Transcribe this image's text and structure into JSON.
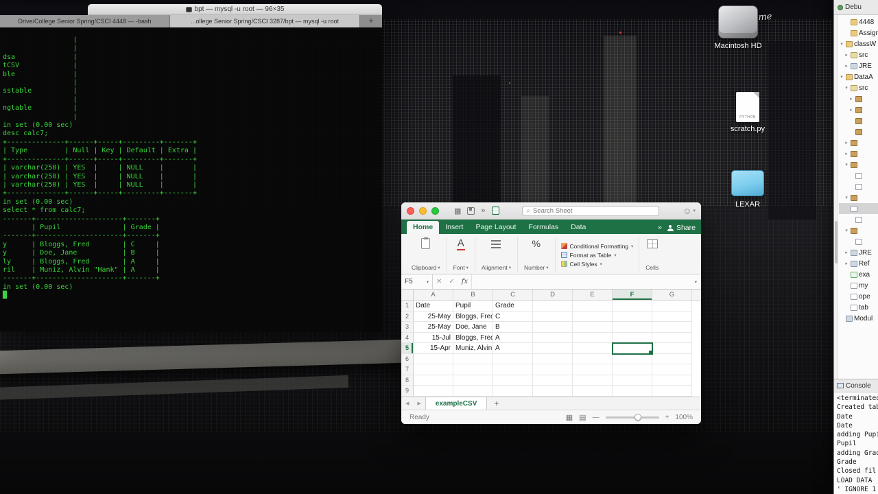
{
  "colors": {
    "excel_green": "#1e7145",
    "terminal_green": "#3cd43c"
  },
  "icons": {
    "search": "⌕",
    "smiley": "☺",
    "chevron_down": "▾",
    "overflow": "»",
    "cancel": "✕",
    "enter": "✓",
    "fx": "fx",
    "prev": "◀",
    "next": "▶",
    "plus": "+",
    "minus": "—",
    "grid_view": "▦",
    "page_view": "▤",
    "font": "A",
    "percent": "%"
  },
  "wallpaper": {
    "watermark": "b.me"
  },
  "terminal": {
    "title": "bpt — mysql -u root — 96×35",
    "new_tab_label": "+",
    "tabs": [
      {
        "label": "Drive/College Senior Spring/CSCI 4448 — -bash",
        "active": false
      },
      {
        "label": "...ollege Senior Spring/CSCI 3287/bpt — mysql -u root",
        "active": true
      }
    ],
    "lines": [
      "                 |",
      "                 |",
      "dsa              |",
      "tCSV             |",
      "ble              |",
      "                 |",
      "sstable          |",
      "                 |",
      "ngtable          |",
      "                 |",
      "in set (0.00 sec)",
      "",
      "desc calc7;",
      "+--------------+------+-----+---------+-------+",
      "| Type         | Null | Key | Default | Extra |",
      "+--------------+------+-----+---------+-------+",
      "| varchar(250) | YES  |     | NULL    |       |",
      "| varchar(250) | YES  |     | NULL    |       |",
      "| varchar(250) | YES  |     | NULL    |       |",
      "+--------------+------+-----+---------+-------+",
      "in set (0.00 sec)",
      "",
      "select * from calc7;",
      "-------+---------------------+-------+",
      "       | Pupil               | Grade |",
      "-------+---------------------+-------+",
      "y      | Bloggs, Fred        | C     |",
      "y      | Doe, Jane           | B     |",
      "ly     | Bloggs, Fred        | A     |",
      "ril    | Muniz, Alvin \"Hank\" | A     |",
      "-------+---------------------+-------+",
      "in set (0.00 sec)",
      "█"
    ]
  },
  "excel": {
    "search": {
      "placeholder": "Search Sheet"
    },
    "ribbon_tabs": [
      {
        "label": "Home",
        "active": true
      },
      {
        "label": "Insert",
        "active": false
      },
      {
        "label": "Page Layout",
        "active": false
      },
      {
        "label": "Formulas",
        "active": false
      },
      {
        "label": "Data",
        "active": false
      }
    ],
    "overflow_chevron": "»",
    "share_label": "Share",
    "ribbon_groups": {
      "clipboard": "Clipboard",
      "font": "Font",
      "alignment": "Alignment",
      "number": "Number",
      "conditional_formatting": "Conditional Formatting",
      "format_as_table": "Format as Table",
      "cell_styles": "Cell Styles",
      "cells": "Cells"
    },
    "formula_bar": {
      "name_box": "F5",
      "fx": "fx"
    },
    "grid": {
      "columns": [
        "A",
        "B",
        "C",
        "D",
        "E",
        "F",
        "G"
      ],
      "selected_cell": {
        "col": "F",
        "row": 5
      },
      "rows": [
        {
          "n": 1,
          "cells": {
            "A": "Date",
            "B": "Pupil",
            "C": "Grade"
          }
        },
        {
          "n": 2,
          "cells": {
            "A": "25-May",
            "B": "Bloggs, Fred",
            "C": "C"
          }
        },
        {
          "n": 3,
          "cells": {
            "A": "25-May",
            "B": "Doe, Jane",
            "C": "B"
          }
        },
        {
          "n": 4,
          "cells": {
            "A": "15-Jul",
            "B": "Bloggs, Fred",
            "C": "A"
          }
        },
        {
          "n": 5,
          "cells": {
            "A": "15-Apr",
            "B": "Muniz, Alvin",
            "C": "A"
          }
        },
        {
          "n": 6,
          "cells": {}
        },
        {
          "n": 7,
          "cells": {}
        },
        {
          "n": 8,
          "cells": {}
        },
        {
          "n": 9,
          "cells": {}
        }
      ]
    },
    "sheet_tabs": {
      "active": "exampleCSV",
      "add": "+"
    },
    "status_bar": {
      "ready": "Ready",
      "zoom": "100%"
    }
  },
  "eclipse": {
    "toolbar_label": "Debu",
    "tree": [
      {
        "i": 1,
        "a": "",
        "icon": "folder",
        "label": "4448"
      },
      {
        "i": 1,
        "a": "",
        "icon": "folder",
        "label": "Assign"
      },
      {
        "i": 0,
        "a": "v",
        "icon": "project",
        "label": "classW"
      },
      {
        "i": 1,
        "a": ">",
        "icon": "src",
        "label": "src"
      },
      {
        "i": 1,
        "a": ">",
        "icon": "lib",
        "label": "JRE"
      },
      {
        "i": 0,
        "a": "v",
        "icon": "project",
        "label": "DataA"
      },
      {
        "i": 1,
        "a": "v",
        "icon": "src",
        "label": "src"
      },
      {
        "i": 2,
        "a": ">",
        "icon": "pkg",
        "label": ""
      },
      {
        "i": 2,
        "a": ">",
        "icon": "pkg",
        "label": ""
      },
      {
        "i": 2,
        "a": "",
        "icon": "pkg",
        "label": ""
      },
      {
        "i": 2,
        "a": "",
        "icon": "pkg",
        "label": ""
      },
      {
        "i": 1,
        "a": ">",
        "icon": "pkg",
        "label": ""
      },
      {
        "i": 1,
        "a": ">",
        "icon": "pkg",
        "label": ""
      },
      {
        "i": 1,
        "a": "v",
        "icon": "pkg",
        "label": ""
      },
      {
        "i": 2,
        "a": "",
        "icon": "file",
        "label": ""
      },
      {
        "i": 2,
        "a": "",
        "icon": "file",
        "label": ""
      },
      {
        "i": 1,
        "a": "v",
        "icon": "pkg",
        "label": ""
      },
      {
        "i": 2,
        "a": "",
        "icon": "file",
        "label": "",
        "selected": true
      },
      {
        "i": 2,
        "a": "",
        "icon": "file",
        "label": ""
      },
      {
        "i": 1,
        "a": "v",
        "icon": "pkg",
        "label": ""
      },
      {
        "i": 2,
        "a": "",
        "icon": "file",
        "label": ""
      },
      {
        "i": 1,
        "a": ">",
        "icon": "lib",
        "label": "JRE"
      },
      {
        "i": 1,
        "a": ">",
        "icon": "lib",
        "label": "Ref"
      },
      {
        "i": 1,
        "a": "",
        "icon": "xfile",
        "label": "exa"
      },
      {
        "i": 1,
        "a": "",
        "icon": "file",
        "label": "my"
      },
      {
        "i": 1,
        "a": "",
        "icon": "file",
        "label": "ope"
      },
      {
        "i": 1,
        "a": "",
        "icon": "file",
        "label": "tab"
      },
      {
        "i": 0,
        "a": "",
        "icon": "lib",
        "label": "Modul"
      }
    ],
    "console": {
      "tab": "Console",
      "lines": [
        "<terminated:",
        "Created tab",
        "Date",
        "Date",
        "adding Pupi",
        "Pupil",
        "adding Grad",
        "Grade",
        "Closed fil",
        "LOAD DATA",
        "' IGNORE 1"
      ]
    }
  },
  "desktop": {
    "icons": [
      {
        "label": "Macintosh HD",
        "type": "hd"
      },
      {
        "label": "scratch.py",
        "type": "file",
        "badge": "PYTHON"
      },
      {
        "label": "LEXAR",
        "type": "usb"
      }
    ]
  }
}
